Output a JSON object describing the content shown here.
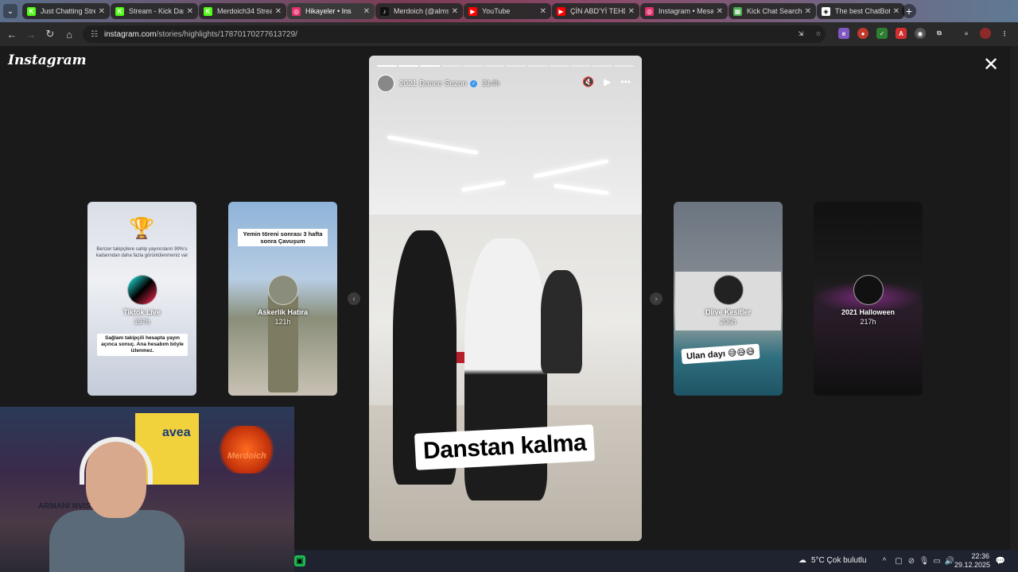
{
  "browser": {
    "tabs": [
      {
        "title": "Just Chatting Stre",
        "favicon": "K",
        "color": "#53fc18",
        "active": false
      },
      {
        "title": "Stream - Kick Das",
        "favicon": "K",
        "color": "#53fc18",
        "active": false
      },
      {
        "title": "Merdoich34 Strea",
        "favicon": "K",
        "color": "#53fc18",
        "active": false
      },
      {
        "title": "Hikayeler • Ins",
        "favicon": "◎",
        "color": "#e1306c",
        "active": true
      },
      {
        "title": "Merdoich (@alms",
        "favicon": "♪",
        "color": "#111111",
        "active": false
      },
      {
        "title": "YouTube",
        "favicon": "▶",
        "color": "#ff0000",
        "active": false
      },
      {
        "title": "ÇİN ABD'Yİ TEHD",
        "favicon": "▶",
        "color": "#ff0000",
        "active": false
      },
      {
        "title": "Instagram • Mesa",
        "favicon": "◎",
        "color": "#e1306c",
        "active": false
      },
      {
        "title": "Kick Chat Search",
        "favicon": "▦",
        "color": "#4caf50",
        "active": false
      },
      {
        "title": "The best ChatBot",
        "favicon": "◈",
        "color": "#ffffff",
        "active": false
      }
    ],
    "url_host": "instagram.com",
    "url_path": "/stories/highlights/17870170277613729/"
  },
  "instagram": {
    "logo": "Instagram",
    "story": {
      "username": "2021 Dance Sezon",
      "time": "214h",
      "caption": "Danstan kalma",
      "segments": 12,
      "segments_done": 3
    },
    "highlights_left": [
      {
        "title": "Tiktok Live",
        "time": "157h",
        "bg": "linear-gradient(180deg,#d9dde6,#eef0f4 40%,#c4cbd9)",
        "text_top": "Benzer takipçilere sahip yayıncıların 99%'u kadarından daha fazla görüntülenmeniz var",
        "text_bottom": "Sağlam takipçili hesapta yayın açınca sonuç. Ana hesabım böyle izlenmez."
      },
      {
        "title": "Askerlik Hatıra",
        "time": "121h",
        "bg": "linear-gradient(180deg,#8fb3d9 0%,#b7cde3 40%,#8a8f7a 60%,#c9c2b4 100%)",
        "text_top": "Yemin töreni sonrası 3 hafta sonra Çavuşum"
      }
    ],
    "highlights_right": [
      {
        "title": "Dlive Kesitler",
        "time": "206h",
        "bg": "linear-gradient(180deg,#6b7580 0%,#80878f 35%,#b6b0a8 55%,#2f6f7f 80%,#1e5464 100%)",
        "text_bottom": "Ulan dayı 😅😅😅"
      },
      {
        "title": "2021 Halloween",
        "time": "217h",
        "bg": "linear-gradient(180deg,#111 0%,#1b1b1b 40%,#2a1d2a 55%,#101010 100%)"
      }
    ]
  },
  "webcam": {
    "flag_text": "avea",
    "neon_text": "Merdoich",
    "shirt_text": "ARMANİ NVIS"
  },
  "taskbar": {
    "weather": "5°C  Çok bulutlu",
    "time": "22:36",
    "date": "29.12.2025"
  }
}
